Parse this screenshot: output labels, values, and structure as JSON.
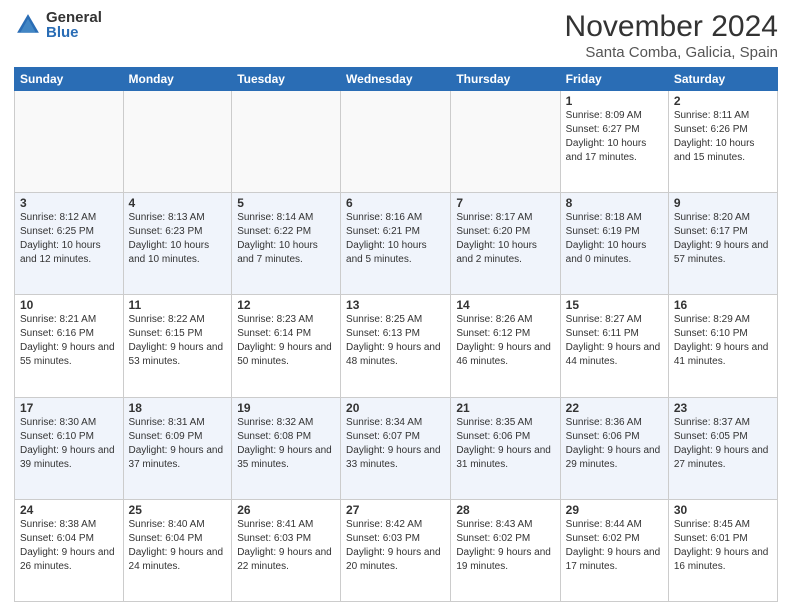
{
  "logo": {
    "general": "General",
    "blue": "Blue"
  },
  "header": {
    "month": "November 2024",
    "location": "Santa Comba, Galicia, Spain"
  },
  "weekdays": [
    "Sunday",
    "Monday",
    "Tuesday",
    "Wednesday",
    "Thursday",
    "Friday",
    "Saturday"
  ],
  "weeks": [
    [
      {
        "day": "",
        "info": ""
      },
      {
        "day": "",
        "info": ""
      },
      {
        "day": "",
        "info": ""
      },
      {
        "day": "",
        "info": ""
      },
      {
        "day": "",
        "info": ""
      },
      {
        "day": "1",
        "info": "Sunrise: 8:09 AM\nSunset: 6:27 PM\nDaylight: 10 hours and 17 minutes."
      },
      {
        "day": "2",
        "info": "Sunrise: 8:11 AM\nSunset: 6:26 PM\nDaylight: 10 hours and 15 minutes."
      }
    ],
    [
      {
        "day": "3",
        "info": "Sunrise: 8:12 AM\nSunset: 6:25 PM\nDaylight: 10 hours and 12 minutes."
      },
      {
        "day": "4",
        "info": "Sunrise: 8:13 AM\nSunset: 6:23 PM\nDaylight: 10 hours and 10 minutes."
      },
      {
        "day": "5",
        "info": "Sunrise: 8:14 AM\nSunset: 6:22 PM\nDaylight: 10 hours and 7 minutes."
      },
      {
        "day": "6",
        "info": "Sunrise: 8:16 AM\nSunset: 6:21 PM\nDaylight: 10 hours and 5 minutes."
      },
      {
        "day": "7",
        "info": "Sunrise: 8:17 AM\nSunset: 6:20 PM\nDaylight: 10 hours and 2 minutes."
      },
      {
        "day": "8",
        "info": "Sunrise: 8:18 AM\nSunset: 6:19 PM\nDaylight: 10 hours and 0 minutes."
      },
      {
        "day": "9",
        "info": "Sunrise: 8:20 AM\nSunset: 6:17 PM\nDaylight: 9 hours and 57 minutes."
      }
    ],
    [
      {
        "day": "10",
        "info": "Sunrise: 8:21 AM\nSunset: 6:16 PM\nDaylight: 9 hours and 55 minutes."
      },
      {
        "day": "11",
        "info": "Sunrise: 8:22 AM\nSunset: 6:15 PM\nDaylight: 9 hours and 53 minutes."
      },
      {
        "day": "12",
        "info": "Sunrise: 8:23 AM\nSunset: 6:14 PM\nDaylight: 9 hours and 50 minutes."
      },
      {
        "day": "13",
        "info": "Sunrise: 8:25 AM\nSunset: 6:13 PM\nDaylight: 9 hours and 48 minutes."
      },
      {
        "day": "14",
        "info": "Sunrise: 8:26 AM\nSunset: 6:12 PM\nDaylight: 9 hours and 46 minutes."
      },
      {
        "day": "15",
        "info": "Sunrise: 8:27 AM\nSunset: 6:11 PM\nDaylight: 9 hours and 44 minutes."
      },
      {
        "day": "16",
        "info": "Sunrise: 8:29 AM\nSunset: 6:10 PM\nDaylight: 9 hours and 41 minutes."
      }
    ],
    [
      {
        "day": "17",
        "info": "Sunrise: 8:30 AM\nSunset: 6:10 PM\nDaylight: 9 hours and 39 minutes."
      },
      {
        "day": "18",
        "info": "Sunrise: 8:31 AM\nSunset: 6:09 PM\nDaylight: 9 hours and 37 minutes."
      },
      {
        "day": "19",
        "info": "Sunrise: 8:32 AM\nSunset: 6:08 PM\nDaylight: 9 hours and 35 minutes."
      },
      {
        "day": "20",
        "info": "Sunrise: 8:34 AM\nSunset: 6:07 PM\nDaylight: 9 hours and 33 minutes."
      },
      {
        "day": "21",
        "info": "Sunrise: 8:35 AM\nSunset: 6:06 PM\nDaylight: 9 hours and 31 minutes."
      },
      {
        "day": "22",
        "info": "Sunrise: 8:36 AM\nSunset: 6:06 PM\nDaylight: 9 hours and 29 minutes."
      },
      {
        "day": "23",
        "info": "Sunrise: 8:37 AM\nSunset: 6:05 PM\nDaylight: 9 hours and 27 minutes."
      }
    ],
    [
      {
        "day": "24",
        "info": "Sunrise: 8:38 AM\nSunset: 6:04 PM\nDaylight: 9 hours and 26 minutes."
      },
      {
        "day": "25",
        "info": "Sunrise: 8:40 AM\nSunset: 6:04 PM\nDaylight: 9 hours and 24 minutes."
      },
      {
        "day": "26",
        "info": "Sunrise: 8:41 AM\nSunset: 6:03 PM\nDaylight: 9 hours and 22 minutes."
      },
      {
        "day": "27",
        "info": "Sunrise: 8:42 AM\nSunset: 6:03 PM\nDaylight: 9 hours and 20 minutes."
      },
      {
        "day": "28",
        "info": "Sunrise: 8:43 AM\nSunset: 6:02 PM\nDaylight: 9 hours and 19 minutes."
      },
      {
        "day": "29",
        "info": "Sunrise: 8:44 AM\nSunset: 6:02 PM\nDaylight: 9 hours and 17 minutes."
      },
      {
        "day": "30",
        "info": "Sunrise: 8:45 AM\nSunset: 6:01 PM\nDaylight: 9 hours and 16 minutes."
      }
    ]
  ]
}
